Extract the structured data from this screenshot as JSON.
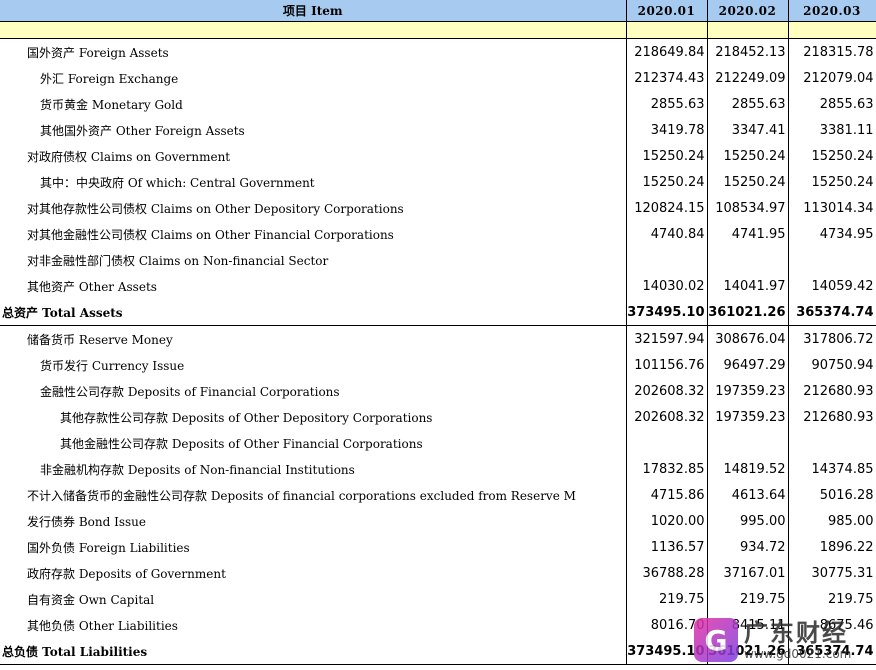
{
  "header": {
    "item": "项目 Item",
    "periods": [
      "2020.01",
      "2020.02",
      "2020.03"
    ]
  },
  "rows": [
    {
      "label": "国外资产  Foreign Assets",
      "indent": 1,
      "bold": false,
      "values": [
        "218649.84",
        "218452.13",
        "218315.78"
      ]
    },
    {
      "label": "外汇  Foreign Exchange",
      "indent": 2,
      "bold": false,
      "values": [
        "212374.43",
        "212249.09",
        "212079.04"
      ]
    },
    {
      "label": "货币黄金  Monetary Gold",
      "indent": 2,
      "bold": false,
      "values": [
        "2855.63",
        "2855.63",
        "2855.63"
      ]
    },
    {
      "label": "其他国外资产  Other Foreign Assets",
      "indent": 2,
      "bold": false,
      "values": [
        "3419.78",
        "3347.41",
        "3381.11"
      ]
    },
    {
      "label": "对政府债权  Claims on Government",
      "indent": 1,
      "bold": false,
      "values": [
        "15250.24",
        "15250.24",
        "15250.24"
      ]
    },
    {
      "label": "其中：中央政府  Of which: Central Government",
      "indent": 2,
      "bold": false,
      "values": [
        "15250.24",
        "15250.24",
        "15250.24"
      ]
    },
    {
      "label": "对其他存款性公司债权  Claims on Other Depository Corporations",
      "indent": 1,
      "bold": false,
      "values": [
        "120824.15",
        "108534.97",
        "113014.34"
      ]
    },
    {
      "label": "对其他金融性公司债权  Claims on Other Financial Corporations",
      "indent": 1,
      "bold": false,
      "values": [
        "4740.84",
        "4741.95",
        "4734.95"
      ]
    },
    {
      "label": "对非金融性部门债权  Claims on Non-financial Sector",
      "indent": 1,
      "bold": false,
      "values": [
        "",
        "",
        ""
      ]
    },
    {
      "label": "其他资产  Other Assets",
      "indent": 1,
      "bold": false,
      "values": [
        "14030.02",
        "14041.97",
        "14059.42"
      ]
    },
    {
      "label": "总资产  Total Assets",
      "indent": 0,
      "bold": true,
      "values": [
        "373495.10",
        "361021.26",
        "365374.74"
      ]
    },
    {
      "label": "储备货币  Reserve Money",
      "indent": 1,
      "bold": false,
      "values": [
        "321597.94",
        "308676.04",
        "317806.72"
      ]
    },
    {
      "label": "货币发行  Currency Issue",
      "indent": 2,
      "bold": false,
      "values": [
        "101156.76",
        "96497.29",
        "90750.94"
      ]
    },
    {
      "label": "金融性公司存款  Deposits of  Financial Corporations",
      "indent": 2,
      "bold": false,
      "values": [
        "202608.32",
        "197359.23",
        "212680.93"
      ]
    },
    {
      "label": "其他存款性公司存款  Deposits of  Other Depository Corporations",
      "indent": 3,
      "bold": false,
      "values": [
        "202608.32",
        "197359.23",
        "212680.93"
      ]
    },
    {
      "label": "其他金融性公司存款  Deposits of  Other Financial Corporations",
      "indent": 3,
      "bold": false,
      "values": [
        "",
        "",
        ""
      ]
    },
    {
      "label": "非金融机构存款 Deposits of  Non-financial Institutions",
      "indent": 2,
      "bold": false,
      "values": [
        "17832.85",
        "14819.52",
        "14374.85"
      ]
    },
    {
      "label": "不计入储备货币的金融性公司存款  Deposits of financial corporations excluded from Reserve M",
      "indent": 1,
      "bold": false,
      "values": [
        "4715.86",
        "4613.64",
        "5016.28"
      ]
    },
    {
      "label": "发行债券  Bond Issue",
      "indent": 1,
      "bold": false,
      "values": [
        "1020.00",
        "995.00",
        "985.00"
      ]
    },
    {
      "label": "国外负债  Foreign Liabilities",
      "indent": 1,
      "bold": false,
      "values": [
        "1136.57",
        "934.72",
        "1896.22"
      ]
    },
    {
      "label": "政府存款  Deposits of Government",
      "indent": 1,
      "bold": false,
      "values": [
        "36788.28",
        "37167.01",
        "30775.31"
      ]
    },
    {
      "label": "自有资金  Own Capital",
      "indent": 1,
      "bold": false,
      "values": [
        "219.75",
        "219.75",
        "219.75"
      ]
    },
    {
      "label": "其他负债  Other Liabilities",
      "indent": 1,
      "bold": false,
      "values": [
        "8016.70",
        "8415.11",
        "8675.46"
      ]
    },
    {
      "label": "总负债  Total  Liabilities",
      "indent": 0,
      "bold": true,
      "values": [
        "373495.10",
        "361021.26",
        "365374.74"
      ]
    }
  ],
  "watermark": {
    "logo_icon": "gd-logo-icon",
    "name": "广东财经",
    "url": "www.gd0021.com"
  },
  "colors": {
    "header_bg": "#a6caf0",
    "band_bg": "#ffffc0"
  }
}
